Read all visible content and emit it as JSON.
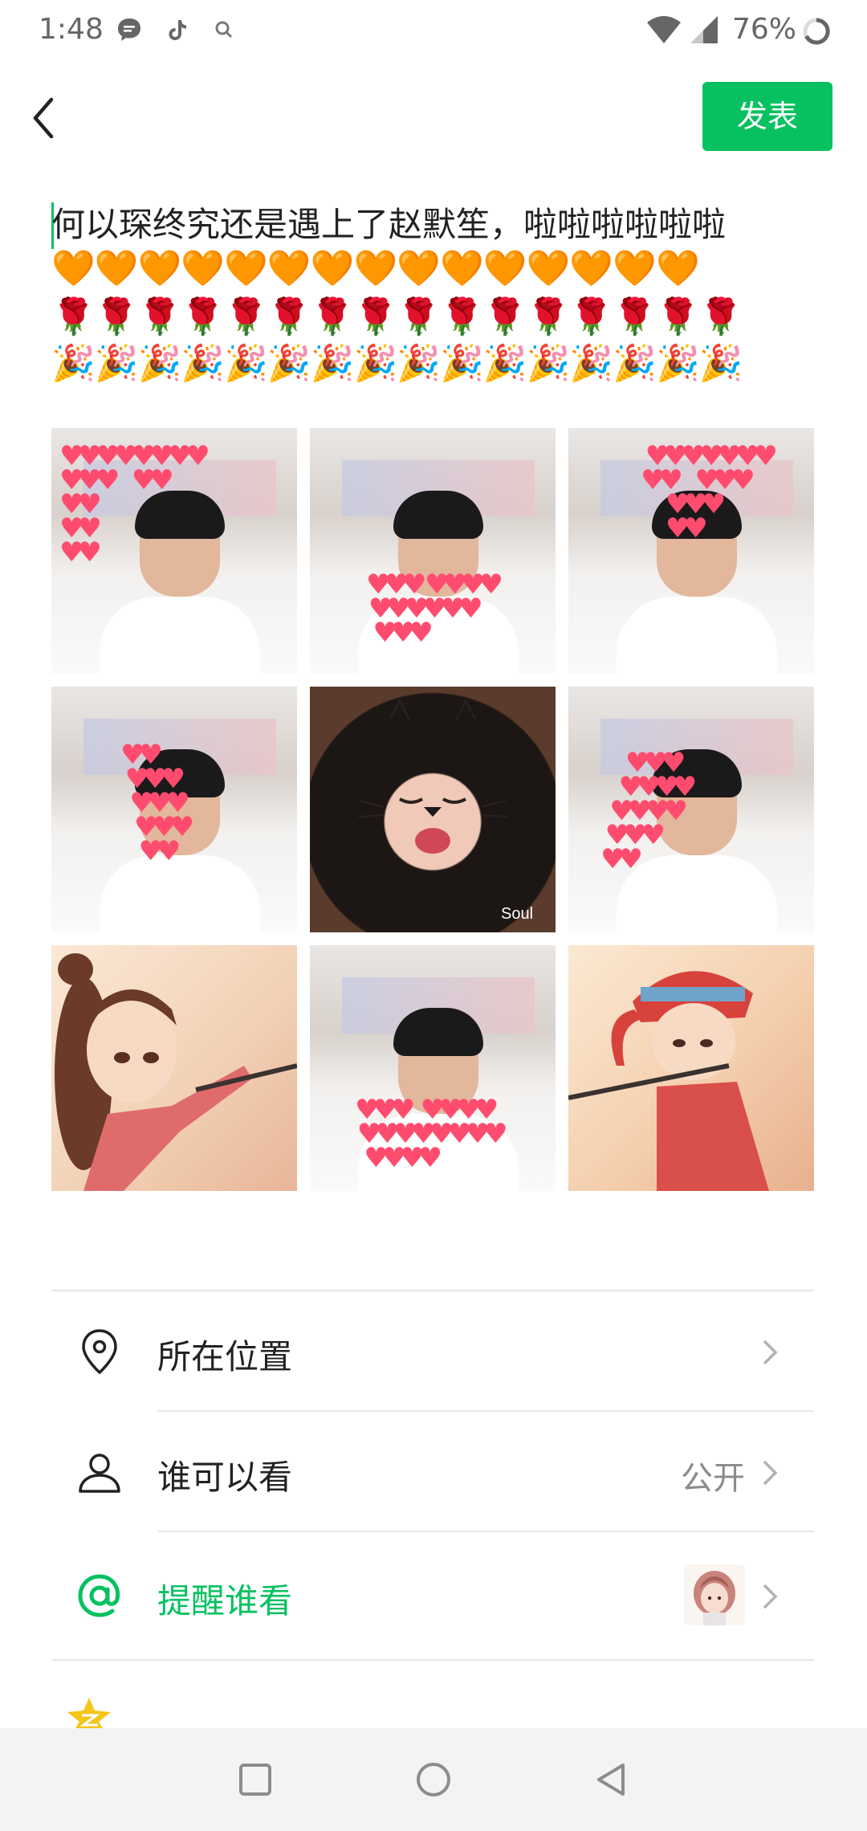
{
  "status_bar": {
    "time": "1:48",
    "battery_percent": "76%",
    "icons": [
      "message-icon",
      "tiktok-icon",
      "search-icon",
      "wifi-icon",
      "signal-icon",
      "battery-ring-icon"
    ]
  },
  "header": {
    "back_icon": "back-arrow-icon",
    "publish_label": "发表",
    "accent_color": "#07c160"
  },
  "post": {
    "text": "何以琛终究还是遇上了赵默笙，啦啦啦啦啦啦",
    "emoji_rows": [
      "🧡🧡🧡🧡🧡🧡🧡🧡🧡🧡🧡🧡🧡🧡🧡",
      "🌹🌹🌹🌹🌹🌹🌹🌹🌹🌹🌹🌹🌹🌹🌹🌹",
      "🎉🎉🎉🎉🎉🎉🎉🎉🎉🎉🎉🎉🎉🎉🎉🎉"
    ]
  },
  "photos": {
    "girl_watermark": "Soul"
  },
  "options": [
    {
      "icon": "location-pin-icon",
      "label": "所在位置",
      "value": ""
    },
    {
      "icon": "person-icon",
      "label": "谁可以看",
      "value": "公开"
    },
    {
      "icon": "at-sign-icon",
      "label": "提醒谁看",
      "value": ""
    }
  ],
  "nav_bar": {
    "buttons": [
      "recents-square-icon",
      "home-circle-icon",
      "back-triangle-icon"
    ]
  }
}
